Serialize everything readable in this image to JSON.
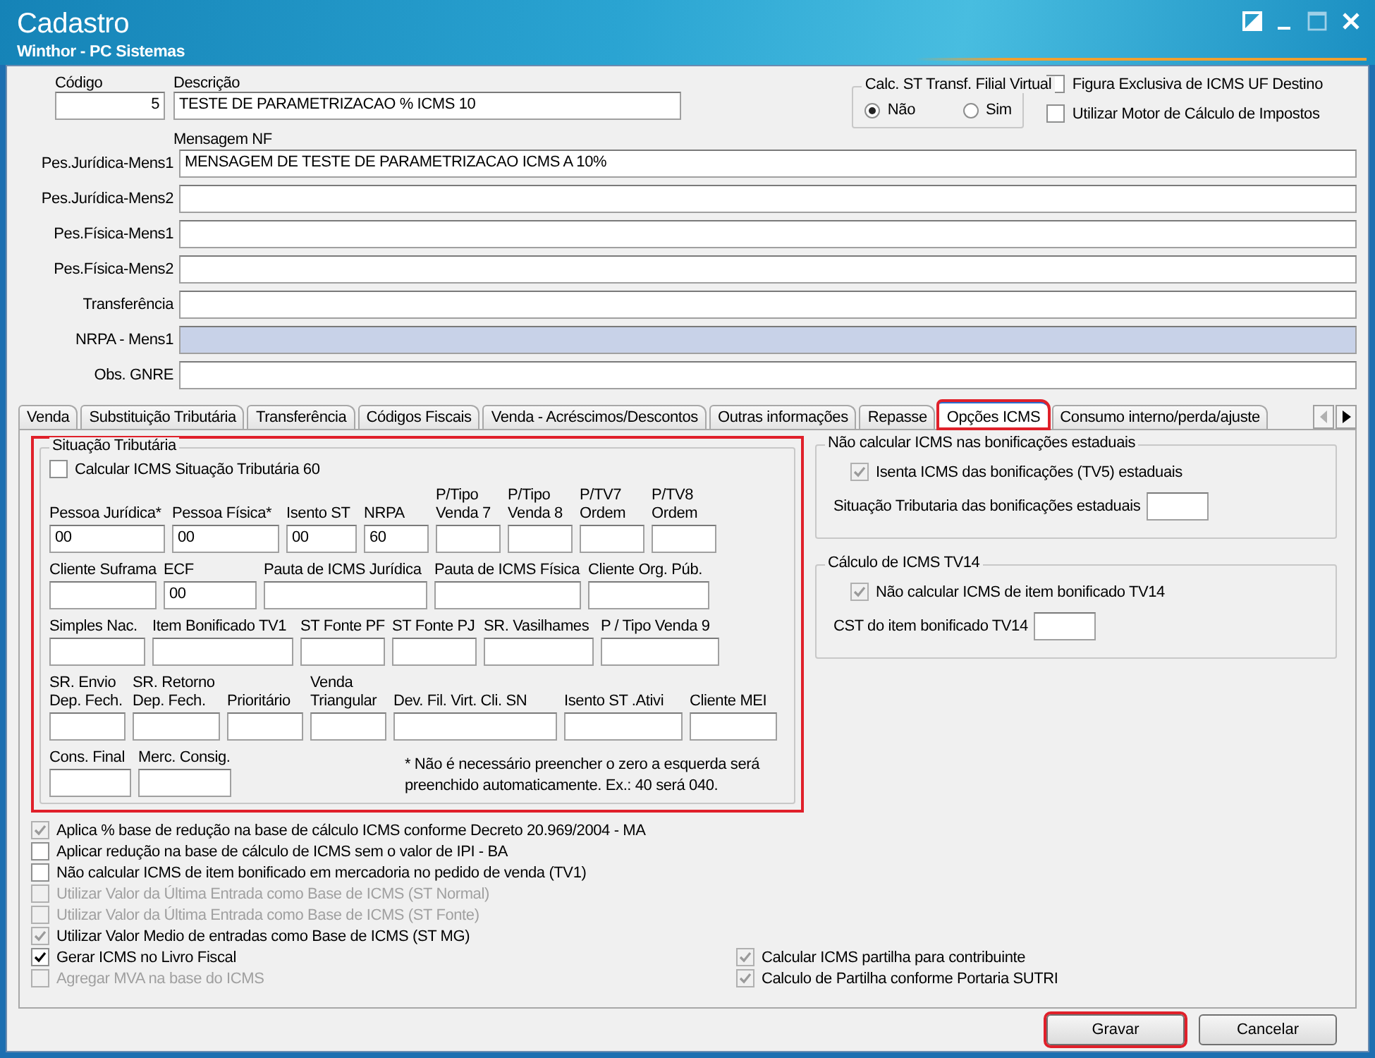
{
  "window": {
    "title": "Cadastro",
    "subtitle": "Winthor - PC Sistemas"
  },
  "header": {
    "code": {
      "label": "Código",
      "value": "5"
    },
    "description": {
      "label": "Descrição",
      "value": "TESTE DE PARAMETRIZACAO % ICMS 10"
    },
    "message_label": "Mensagem NF"
  },
  "calc_st": {
    "title": "Calc. ST Transf. Filial Virtual",
    "options": [
      {
        "label": "Não",
        "selected": true
      },
      {
        "label": "Sim",
        "selected": false
      }
    ]
  },
  "top_checks": [
    {
      "label": "Figura Exclusiva de ICMS UF Destino",
      "checked": false
    },
    {
      "label": "Utilizar Motor de Cálculo de Impostos",
      "checked": false
    }
  ],
  "messages": [
    {
      "label": "Pes.Jurídica-Mens1",
      "value": "MENSAGEM DE TESTE DE PARAMETRIZACAO ICMS A 10%",
      "focused": false
    },
    {
      "label": "Pes.Jurídica-Mens2",
      "focused": false
    },
    {
      "label": "Pes.Física-Mens1",
      "focused": false
    },
    {
      "label": "Pes.Física-Mens2",
      "focused": false
    },
    {
      "label": "Transferência",
      "focused": false
    },
    {
      "label": "NRPA - Mens1",
      "focused": true
    },
    {
      "label": "Obs. GNRE",
      "focused": false
    }
  ],
  "tabs": [
    {
      "label": "Venda",
      "selected": false,
      "highlighted": false
    },
    {
      "label": "Substituição Tributária",
      "selected": false,
      "highlighted": false
    },
    {
      "label": "Transferência",
      "selected": false,
      "highlighted": false
    },
    {
      "label": "Códigos Fiscais",
      "selected": false,
      "highlighted": false
    },
    {
      "label": "Venda - Acréscimos/Descontos",
      "selected": false,
      "highlighted": false
    },
    {
      "label": "Outras informações",
      "selected": false,
      "highlighted": false
    },
    {
      "label": "Repasse",
      "selected": false,
      "highlighted": false
    },
    {
      "label": "Opções ICMS",
      "selected": true,
      "highlighted": true
    },
    {
      "label": "Consumo interno/perda/ajuste",
      "selected": false,
      "highlighted": false
    }
  ],
  "situacao": {
    "title": "Situação Tributária",
    "highlighted": true,
    "check": {
      "label": "Calcular ICMS Situação Tributária 60",
      "checked": false
    },
    "fields": [
      {
        "label": "Pessoa Jurídica*",
        "value": "00"
      },
      {
        "label": "Pessoa Física*",
        "value": "00"
      },
      {
        "label": "Isento ST",
        "value": "00"
      },
      {
        "label": "NRPA",
        "value": "60"
      },
      {
        "label": "P/Tipo Venda 7"
      },
      {
        "label": "P/Tipo Venda 8"
      },
      {
        "label": "P/TV7 Ordem"
      },
      {
        "label": "P/TV8 Ordem"
      },
      {
        "label": "Cliente Suframa"
      },
      {
        "label": "ECF",
        "value": "00"
      },
      {
        "label": "Pauta de ICMS Jurídica"
      },
      {
        "label": "Pauta de ICMS Física"
      },
      {
        "label": "Cliente Org. Púb."
      },
      {
        "label": "Simples Nac."
      },
      {
        "label": "Item Bonificado TV1"
      },
      {
        "label": "ST Fonte PF"
      },
      {
        "label": "ST Fonte PJ"
      },
      {
        "label": "SR. Vasilhames"
      },
      {
        "label": "P / Tipo Venda 9"
      },
      {
        "label": "SR. Envio Dep. Fech."
      },
      {
        "label": "SR. Retorno Dep. Fech."
      },
      {
        "label": "Prioritário"
      },
      {
        "label": "Venda Triangular"
      },
      {
        "label": "Dev. Fil. Virt. Cli. SN"
      },
      {
        "label": "Isento ST .Ativi"
      },
      {
        "label": "Cliente MEI"
      },
      {
        "label": "Cons. Final"
      },
      {
        "label": "Merc. Consig."
      }
    ],
    "note": "* Não é necessário preencher o zero a esquerda será preenchido automaticamente.  Ex.: 40 será 040."
  },
  "groups": [
    {
      "title": "Não calcular ICMS nas bonificações estaduais",
      "check": {
        "label": "Isenta ICMS das bonificações (TV5) estaduais",
        "checked": true,
        "readonly": true
      },
      "field_label": "Situação Tributaria das  bonificações estaduais"
    },
    {
      "title": "Cálculo de ICMS TV14",
      "check": {
        "label": "Não calcular ICMS de item bonificado TV14",
        "checked": true,
        "readonly": true
      },
      "field_label": "CST do item bonificado TV14"
    }
  ],
  "options_left": [
    {
      "label": "Aplica % base de redução na base de cálculo ICMS conforme Decreto 20.969/2004 - MA",
      "checked": true,
      "readonly": true,
      "disabled": false
    },
    {
      "label": "Aplicar redução na base de cálculo de ICMS sem o valor de IPI - BA",
      "checked": false,
      "readonly": false,
      "disabled": false
    },
    {
      "label": "Não calcular ICMS de item bonificado em mercadoria no pedido de venda (TV1)",
      "checked": false,
      "readonly": false,
      "disabled": false
    },
    {
      "label": "Utilizar Valor da Última Entrada como Base de ICMS (ST Normal)",
      "checked": false,
      "readonly": true,
      "disabled": true
    },
    {
      "label": "Utilizar Valor da Última Entrada como Base de ICMS (ST Fonte)",
      "checked": false,
      "readonly": true,
      "disabled": true
    },
    {
      "label": "Utilizar Valor Medio de entradas como Base de ICMS (ST MG)",
      "checked": true,
      "readonly": true,
      "disabled": false
    },
    {
      "label": "Gerar ICMS no Livro Fiscal",
      "checked": true,
      "readonly": false,
      "disabled": false
    },
    {
      "label": "Agregar MVA na base do ICMS",
      "checked": false,
      "readonly": true,
      "disabled": true
    }
  ],
  "options_right": [
    {
      "label": "Calcular ICMS partilha para contribuinte",
      "checked": true,
      "readonly": true,
      "disabled": false
    },
    {
      "label": "Calculo de Partilha conforme Portaria SUTRI",
      "checked": true,
      "readonly": true,
      "disabled": false
    }
  ],
  "buttons": [
    {
      "label": "Gravar",
      "highlighted": true
    },
    {
      "label": "Cancelar",
      "highlighted": false
    }
  ]
}
